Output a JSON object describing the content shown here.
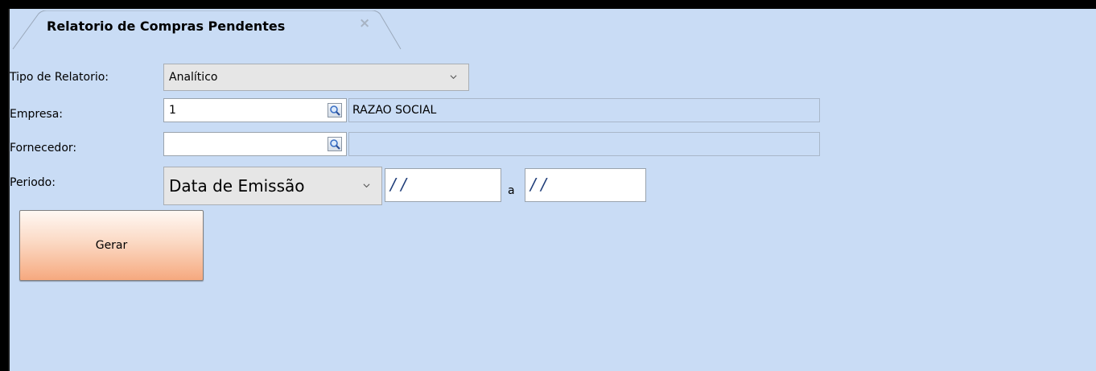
{
  "tab": {
    "title": "Relatorio de Compras Pendentes",
    "close": "×"
  },
  "form": {
    "tipo_label": "Tipo de Relatorio:",
    "tipo_value": "Analítico",
    "empresa_label": "Empresa:",
    "empresa_value": "1",
    "empresa_desc": "RAZAO SOCIAL",
    "fornecedor_label": "Fornecedor:",
    "fornecedor_value": "",
    "fornecedor_desc": "",
    "periodo_label": "Periodo:",
    "periodo_type": "Data de Emissão",
    "date_from": " / /",
    "date_sep": "a",
    "date_to": " / /"
  },
  "buttons": {
    "gerar": "Gerar"
  },
  "colors": {
    "background": "#c9dcf5",
    "button_accent": "#f6a97f"
  },
  "icons": [
    "close-icon",
    "chevron-down-icon",
    "search-icon"
  ]
}
